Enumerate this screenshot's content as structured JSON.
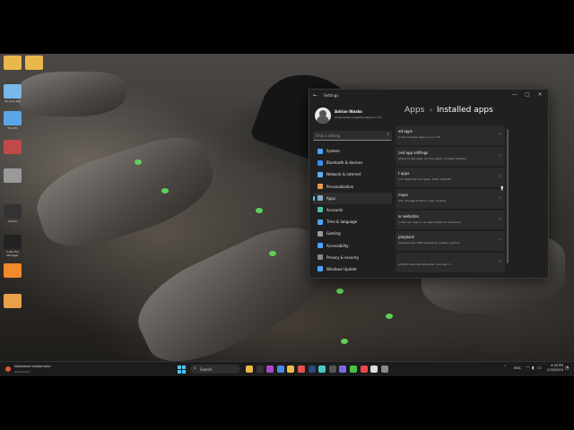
{
  "desktop": {
    "icons": [
      {
        "label": "",
        "color": "#e8b84a"
      },
      {
        "label": "",
        "color": "#e8b84a"
      },
      {
        "label": "Recycle Bin",
        "color": "#7ab8e8"
      },
      {
        "label": "This PC",
        "color": "#5aa6e8"
      },
      {
        "label": "",
        "color": "#c04a4a"
      },
      {
        "label": "",
        "color": "#9a9a9a"
      },
      {
        "label": "Adrian",
        "color": "#333333"
      },
      {
        "label": "7-Zip File Manager",
        "color": "#222222"
      },
      {
        "label": "",
        "color": "#f08a2a"
      },
      {
        "label": "",
        "color": "#e8a04a"
      }
    ]
  },
  "window": {
    "app_title": "Settings",
    "controls": {
      "minimize": "—",
      "maximize": "▢",
      "close": "✕"
    },
    "user": {
      "name": "Adrian Wasko",
      "email": "adrianwasko.wsgadkar@gmail.com"
    },
    "search": {
      "placeholder": "Find a setting"
    },
    "nav": [
      {
        "label": "System",
        "icon": "monitor-icon",
        "color": "#4aa3ff",
        "active": false
      },
      {
        "label": "Bluetooth & devices",
        "icon": "bluetooth-icon",
        "color": "#3b8fe8",
        "active": false
      },
      {
        "label": "Network & internet",
        "icon": "wifi-icon",
        "color": "#5fb0ff",
        "active": false
      },
      {
        "label": "Personalization",
        "icon": "brush-icon",
        "color": "#e89a4a",
        "active": false
      },
      {
        "label": "Apps",
        "icon": "apps-icon",
        "color": "#8fa8c8",
        "active": true
      },
      {
        "label": "Accounts",
        "icon": "person-icon",
        "color": "#4ac0a8",
        "active": false
      },
      {
        "label": "Time & language",
        "icon": "globe-icon",
        "color": "#4aa3ff",
        "active": false
      },
      {
        "label": "Gaming",
        "icon": "gamepad-icon",
        "color": "#9a9a9a",
        "active": false
      },
      {
        "label": "Accessibility",
        "icon": "accessibility-icon",
        "color": "#4aa3ff",
        "active": false
      },
      {
        "label": "Privacy & security",
        "icon": "shield-icon",
        "color": "#8a8a8a",
        "active": false
      },
      {
        "label": "Windows Update",
        "icon": "update-icon",
        "color": "#4aa3ff",
        "active": false
      }
    ],
    "breadcrumb": {
      "root": "Apps",
      "separator": "›",
      "page": "Installed apps"
    },
    "rows": [
      {
        "title": "ed apps",
        "subtitle": "e and manage apps on your PC"
      },
      {
        "title": "ced app settings",
        "subtitle": "where to get apps, archive apps, uninstall updates"
      },
      {
        "title": "t apps",
        "subtitle": "s for files and link types, other defaults"
      },
      {
        "title": "maps",
        "subtitle": "ads, storage location, map updates"
      },
      {
        "title": "or websites",
        "subtitle": "s that can open in an app instead of a browser"
      },
      {
        "title": "playback",
        "subtitle": "adjustments, HDR streaming, battery options"
      },
      {
        "title": "",
        "subtitle": "at start automatically when you sign in"
      }
    ]
  },
  "taskbar": {
    "news": {
      "title": "Najnowsze wiadomości",
      "subtitle": "wiadomości"
    },
    "search_label": "Search",
    "apps": [
      {
        "name": "explorer",
        "color": "#e8b84a"
      },
      {
        "name": "terminal",
        "color": "#333333"
      },
      {
        "name": "media",
        "color": "#a84ac8"
      },
      {
        "name": "store",
        "color": "#4a8ae8"
      },
      {
        "name": "folder",
        "color": "#e8c04a"
      },
      {
        "name": "office",
        "color": "#e8524a"
      },
      {
        "name": "steam",
        "color": "#2a4a7a"
      },
      {
        "name": "edge",
        "color": "#4ac8c8"
      },
      {
        "name": "obs",
        "color": "#555555"
      },
      {
        "name": "discord",
        "color": "#7a6ae8"
      },
      {
        "name": "chrome",
        "color": "#4ac04a"
      },
      {
        "name": "app",
        "color": "#e84a4a"
      },
      {
        "name": "notion",
        "color": "#dddddd"
      },
      {
        "name": "settings",
        "color": "#8a8a8a"
      }
    ],
    "tray": {
      "lang": "ENG",
      "time": "4:18 PM",
      "date": "2/16/2024"
    }
  }
}
